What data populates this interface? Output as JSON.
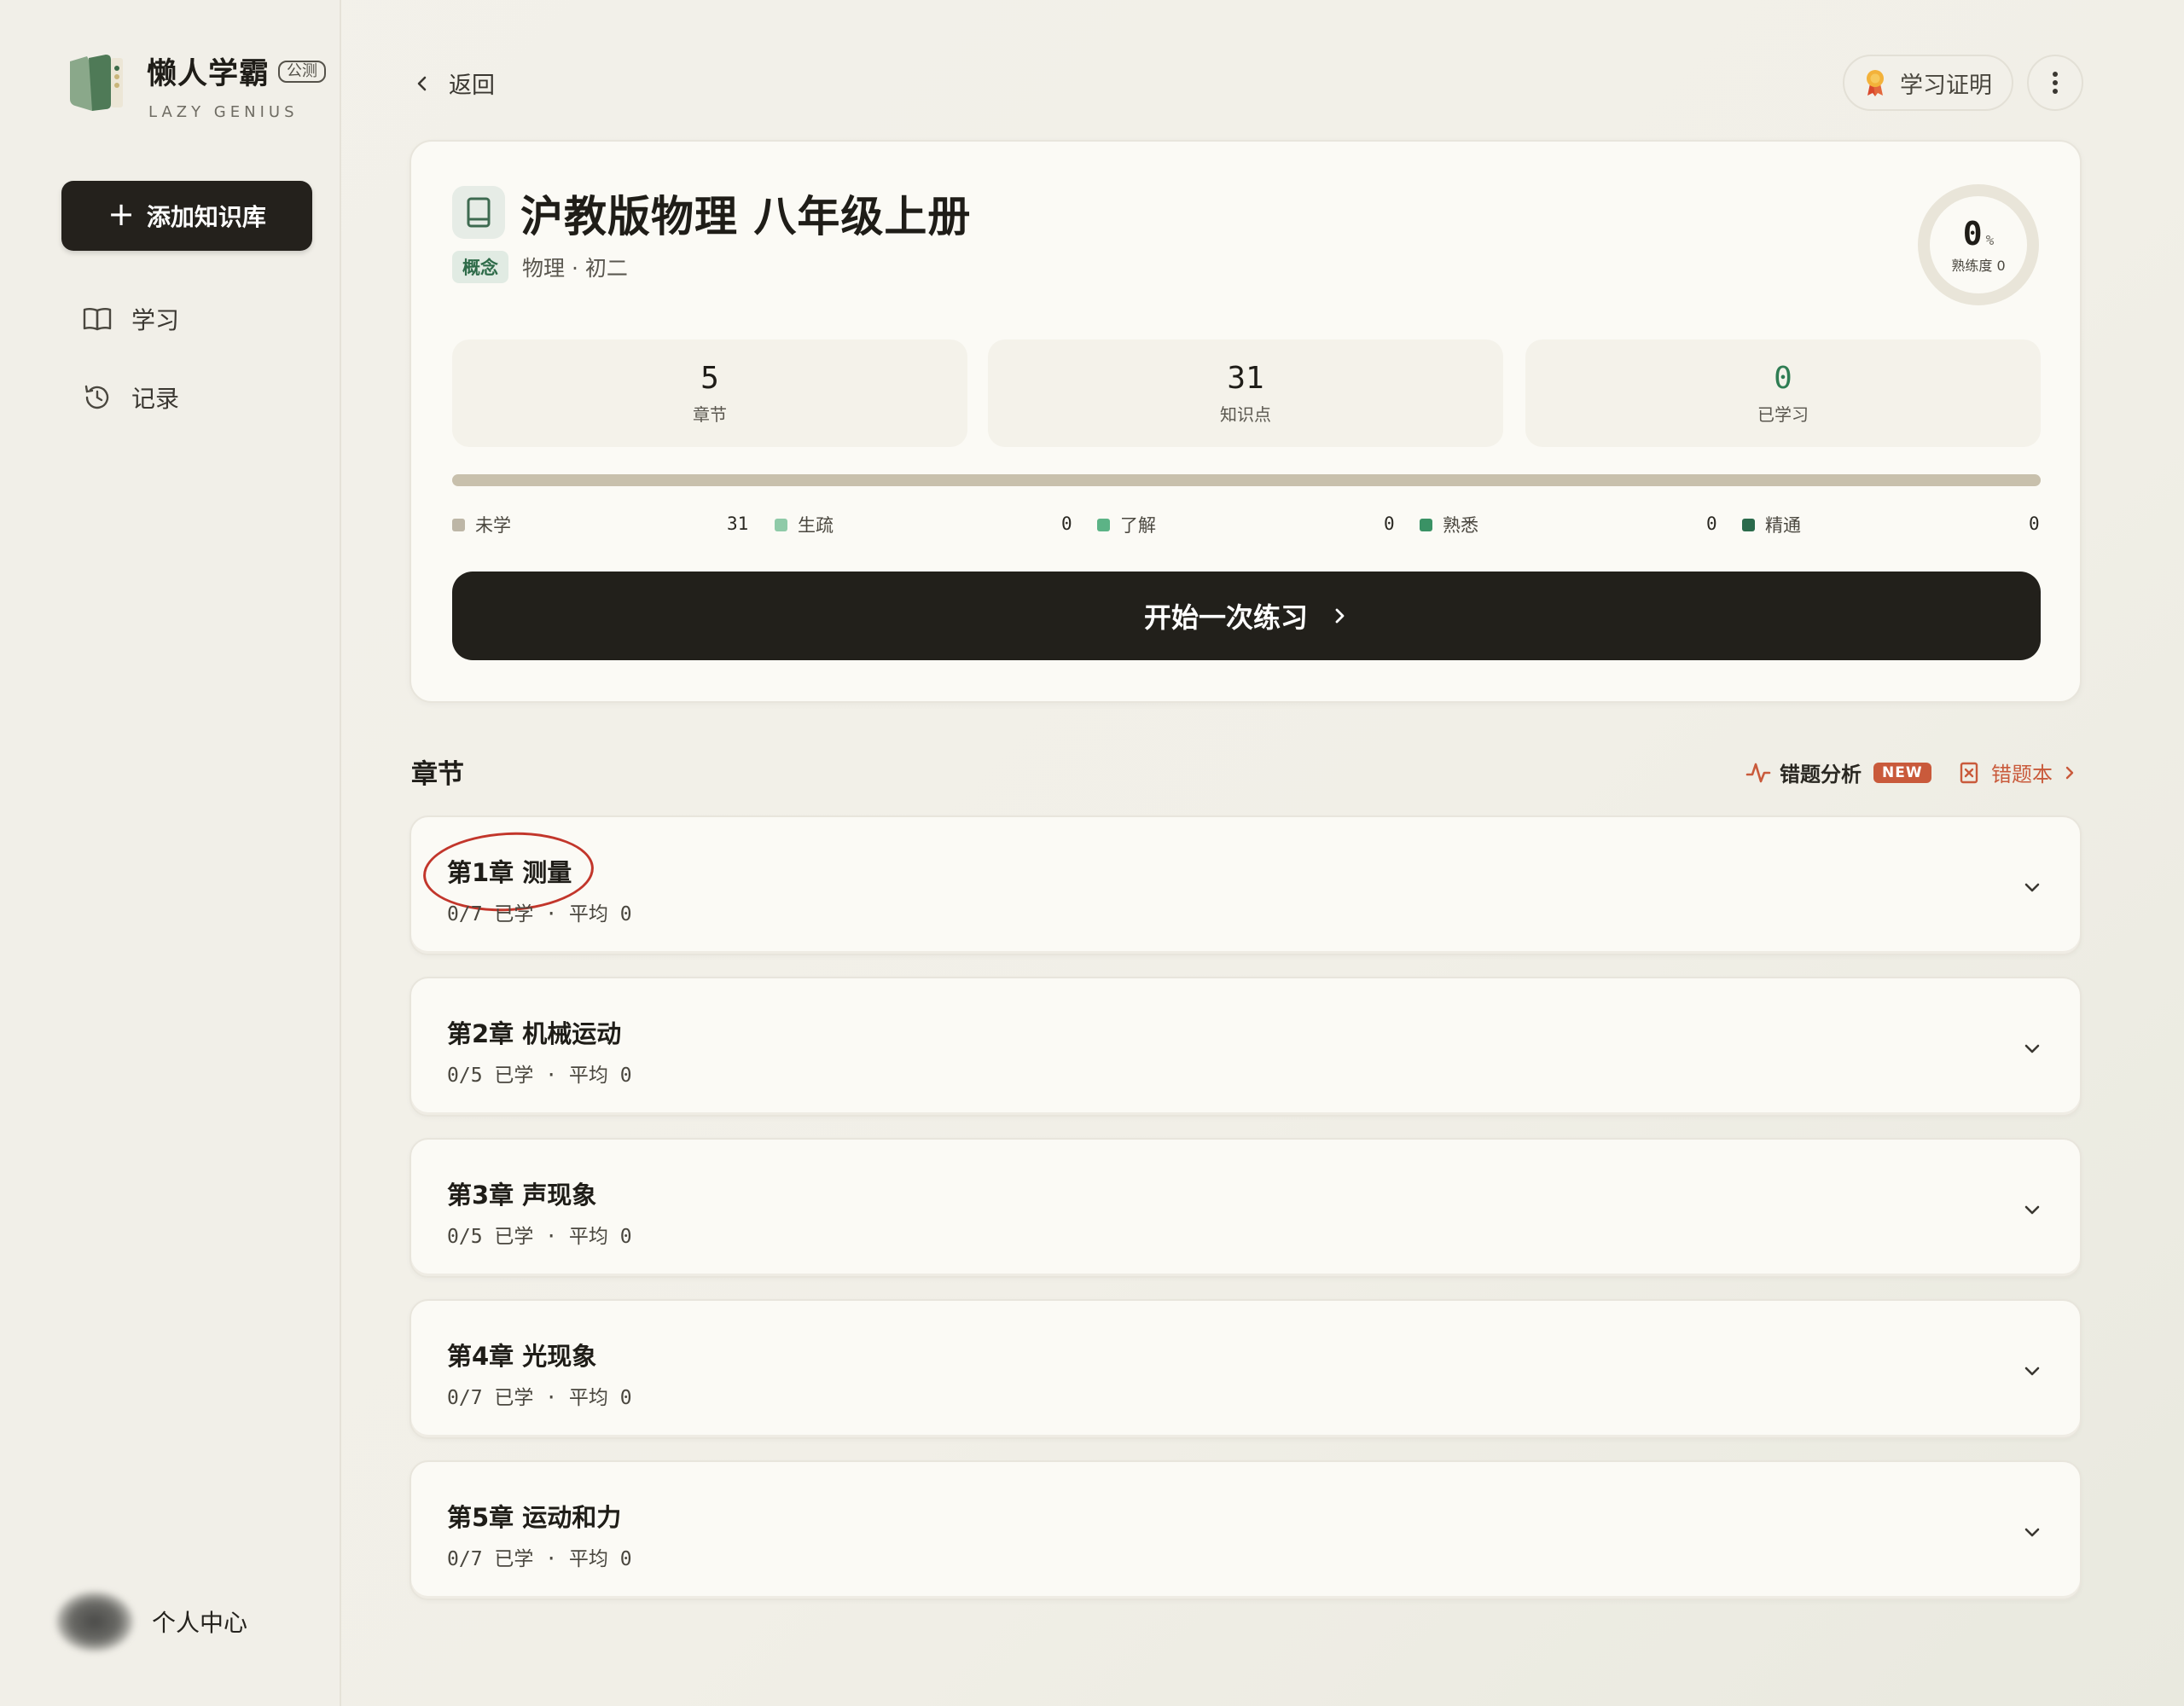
{
  "sidebar": {
    "logo_name": "懒人学霸",
    "beta_badge": "公测",
    "logo_sub": "LAZY GENIUS",
    "add_button": "添加知识库",
    "nav": [
      {
        "label": "学习",
        "icon": "book-open-icon"
      },
      {
        "label": "记录",
        "icon": "history-icon"
      }
    ],
    "profile_label": "个人中心"
  },
  "topbar": {
    "back_label": "返回",
    "cert_label": "学习证明"
  },
  "kb": {
    "title": "沪教版物理 八年级上册",
    "tag": "概念",
    "subtitle": "物理 · 初二",
    "mastery_pct": "0",
    "mastery_unit": "%",
    "mastery_label": "熟练度 0",
    "stats": [
      {
        "value": "5",
        "label": "章节"
      },
      {
        "value": "31",
        "label": "知识点"
      },
      {
        "value": "0",
        "label": "已学习"
      }
    ],
    "legend": [
      {
        "label": "未学",
        "value": "31",
        "color": "#bdb6a6"
      },
      {
        "label": "生疏",
        "value": "0",
        "color": "#8fcaa8"
      },
      {
        "label": "了解",
        "value": "0",
        "color": "#5cb386"
      },
      {
        "label": "熟悉",
        "value": "0",
        "color": "#3a9265"
      },
      {
        "label": "精通",
        "value": "0",
        "color": "#2a6a4b"
      }
    ],
    "start_button": "开始一次练习"
  },
  "chapters_section": {
    "title": "章节",
    "error_analysis": "错题分析",
    "new_badge": "NEW",
    "error_book": "错题本"
  },
  "chapters": [
    {
      "title": "第1章 测量",
      "meta": "0/7 已学 · 平均 0"
    },
    {
      "title": "第2章 机械运动",
      "meta": "0/5 已学 · 平均 0"
    },
    {
      "title": "第3章 声现象",
      "meta": "0/5 已学 · 平均 0"
    },
    {
      "title": "第4章 光现象",
      "meta": "0/7 已学 · 平均 0"
    },
    {
      "title": "第5章 运动和力",
      "meta": "0/7 已学 · 平均 0"
    }
  ],
  "colors": {
    "accent_dark": "#22201b",
    "green": "#2f7d53",
    "error_red": "#c95a3b",
    "circle_red": "#c2362b"
  }
}
